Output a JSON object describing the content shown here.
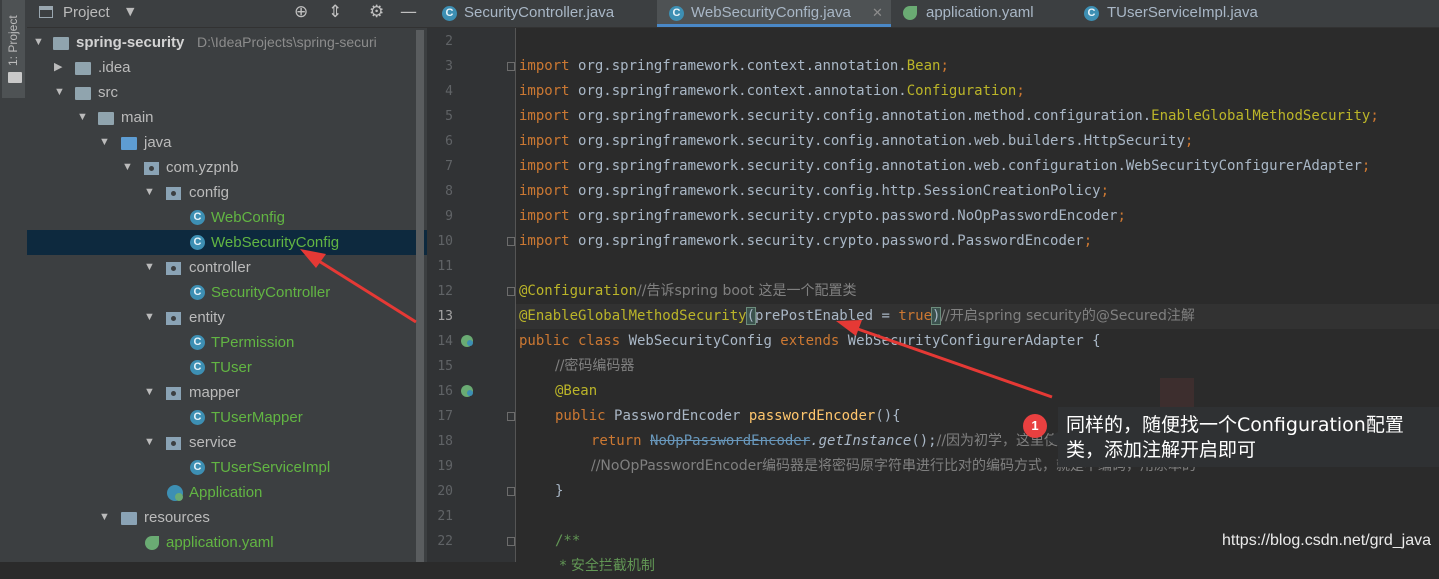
{
  "tool_stripe": {
    "label": "1: Project"
  },
  "project_panel": {
    "title": "Project",
    "tree": [
      {
        "label": "spring-security",
        "path_hint": "D:\\IdeaProjects\\spring-securi",
        "kind": "root"
      },
      {
        "label": ".idea",
        "kind": "folder"
      },
      {
        "label": "src",
        "kind": "folder"
      },
      {
        "label": "main",
        "kind": "folder"
      },
      {
        "label": "java",
        "kind": "source-folder"
      },
      {
        "label": "com.yzpnb",
        "kind": "package"
      },
      {
        "label": "config",
        "kind": "package"
      },
      {
        "label": "WebConfig",
        "kind": "class"
      },
      {
        "label": "WebSecurityConfig",
        "kind": "class",
        "selected": true
      },
      {
        "label": "controller",
        "kind": "package"
      },
      {
        "label": "SecurityController",
        "kind": "class"
      },
      {
        "label": "entity",
        "kind": "package"
      },
      {
        "label": "TPermission",
        "kind": "class"
      },
      {
        "label": "TUser",
        "kind": "class"
      },
      {
        "label": "mapper",
        "kind": "package"
      },
      {
        "label": "TUserMapper",
        "kind": "class"
      },
      {
        "label": "service",
        "kind": "package"
      },
      {
        "label": "TUserServiceImpl",
        "kind": "class"
      },
      {
        "label": "Application",
        "kind": "spring-class"
      },
      {
        "label": "resources",
        "kind": "resources-folder"
      },
      {
        "label": "application.yaml",
        "kind": "spring-config"
      }
    ]
  },
  "editor_tabs": [
    {
      "label": "SecurityController.java",
      "icon": "class-icon",
      "active": false
    },
    {
      "label": "WebSecurityConfig.java",
      "icon": "class-icon",
      "active": true
    },
    {
      "label": "application.yaml",
      "icon": "spring-config-icon",
      "active": false
    },
    {
      "label": "TUserServiceImpl.java",
      "icon": "class-icon",
      "active": false
    }
  ],
  "editor": {
    "current_line": 13,
    "line_numbers": [
      "2",
      "3",
      "4",
      "5",
      "6",
      "7",
      "8",
      "9",
      "10",
      "11",
      "12",
      "13",
      "14",
      "15",
      "16",
      "17",
      "18",
      "19",
      "20",
      "21",
      "22"
    ],
    "code": {
      "l3": {
        "kw": "import ",
        "pkg": "org.springframework.context.annotation.",
        "cls": "Bean",
        "end": ";"
      },
      "l4": {
        "kw": "import ",
        "pkg": "org.springframework.context.annotation.",
        "cls": "Configuration",
        "end": ";"
      },
      "l5": {
        "kw": "import ",
        "pkg": "org.springframework.security.config.annotation.method.configuration.",
        "cls": "EnableGlobalMethodSecurity",
        "end": ";"
      },
      "l6": {
        "kw": "import ",
        "pkg": "org.springframework.security.config.annotation.web.builders.HttpSecurity",
        "end": ";"
      },
      "l7": {
        "kw": "import ",
        "pkg": "org.springframework.security.config.annotation.web.configuration.WebSecurityConfigurerAdapter",
        "end": ";"
      },
      "l8": {
        "kw": "import ",
        "pkg": "org.springframework.security.config.http.SessionCreationPolicy",
        "end": ";"
      },
      "l9": {
        "kw": "import ",
        "pkg": "org.springframework.security.crypto.password.NoOpPasswordEncoder",
        "end": ";"
      },
      "l10": {
        "kw": "import ",
        "pkg": "org.springframework.security.crypto.password.PasswordEncoder",
        "end": ";"
      },
      "l12": {
        "an": "@Configuration",
        "cm": "//告诉spring boot 这是一个配置类"
      },
      "l13": {
        "an": "@EnableGlobalMethodSecurity",
        "open": "(",
        "arg": "prePostEnabled = ",
        "val": "true",
        "close": ")",
        "cm": "//开启spring security的@Secured注解"
      },
      "l14": {
        "kw1": "public class ",
        "name": "WebSecurityConfig ",
        "kw2": "extends ",
        "parent": "WebSecurityConfigurerAdapter {"
      },
      "l15": {
        "cm": "//密码编码器"
      },
      "l16": {
        "an": "@Bean"
      },
      "l17": {
        "kw": "public ",
        "type": "PasswordEncoder ",
        "method": "passwordEncoder",
        "rest": "(){"
      },
      "l18": {
        "kw": "return ",
        "cls": "NoOpPasswordEncoder",
        "call": ".getInstance",
        "rest": "();",
        "cm": "//因为初学，这里使用了一个已经过时了的一个不对密码进行加密的编码器"
      },
      "l19": {
        "cm": "//NoOpPasswordEncoder编码器是将密码原字符串进行比对的编码方式，就是不编码，用原本的"
      },
      "l20": {
        "text": "}"
      },
      "l22": {
        "doc": "/**"
      },
      "l23": {
        "doc": " * 安全拦截机制"
      }
    }
  },
  "annotation": {
    "badge": "1",
    "text": "同样的，随便找一个Configuration配置类，添加注解开启即可"
  },
  "watermark": "https://blog.csdn.net/grd_java",
  "colors": {
    "arrow": "#e53935",
    "selection": "#0d293e",
    "keyword": "#cc7832",
    "annotation": "#bbb529",
    "comment": "#808080",
    "class_green": "#62b543"
  }
}
